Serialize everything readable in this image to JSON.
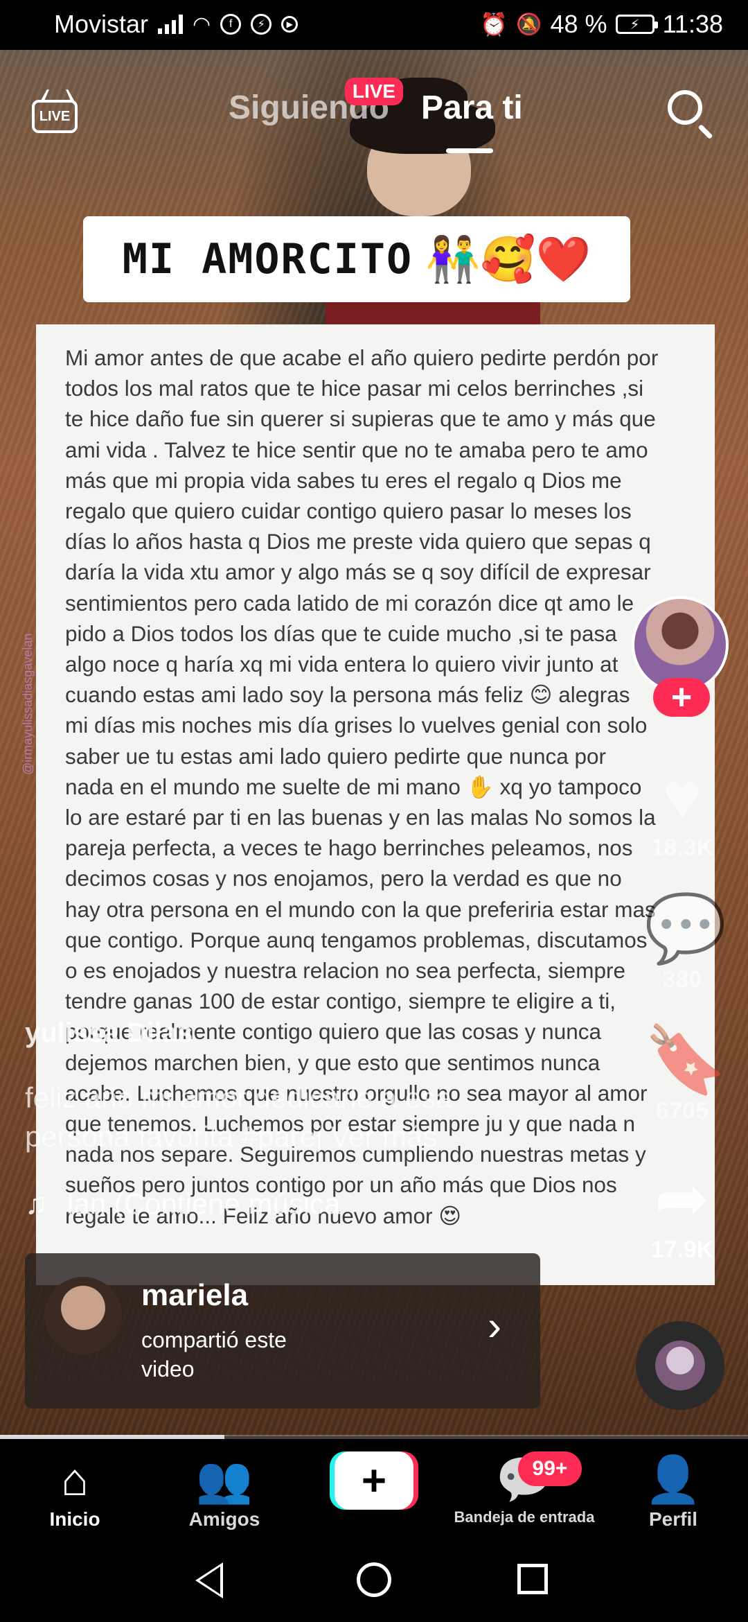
{
  "status_bar": {
    "carrier": "Movistar",
    "battery_percent": "48 %",
    "time": "11:38"
  },
  "top_nav": {
    "live_icon_label": "LIVE",
    "live_badge": "LIVE",
    "tab_following": "Siguiendo",
    "tab_for_you": "Para ti",
    "active_tab": "Para ti"
  },
  "video": {
    "title_card_text": "MI AMORCITO",
    "title_card_emoji": "👫🥰❤️",
    "letter_text": "Mi amor antes de que acabe el año quiero pedirte perdón por\ntodos los mal ratos que te hice pasar mi celos  berrinches ,si\nte hice daño fue sin querer si supieras que te amo y más que\nami vida . Talvez te hice sentir que no te amaba pero te amo\nmás que mi propia vida sabes tu eres el regalo q Dios me\nregalo que quiero cuidar contigo quiero pasar lo meses los\ndías lo años hasta q Dios me preste vida quiero que sepas q\ndaría la vida xtu amor y algo más se q soy difícil de expresar\nsentimientos pero cada latido de mi corazón dice qt amo le\npido a Dios todos los días que te cuide mucho ,si te pasa\nalgo noce q haría xq mi vida entera lo quiero vivir junto at\ncuando estas ami lado soy la persona más feliz 😊 alegras\nmi días mis noches mis día grises lo vuelves genial con solo\nsaber ue tu estas ami lado quiero pedirte que nunca por\nnada en el mundo me suelte de mi mano ✋ xq yo tampoco\nlo are estaré par ti en las buenas y en las malas  No somos la\npareja perfecta, a veces te hago berrinches peleamos, nos\ndecimos cosas y nos enojamos, pero la verdad es que no\nhay otra persona en el mundo con la que preferiria estar mas\nque contigo. Porque aunq tengamos problemas, discutamos\no es enojados y nuestra relacion no sea perfecta, siempre\ntendre ganas 100 de estar contigo, siempre te eligire a ti,\nporque realmente contigo quiero que las cosas y  nunca\ndejemos marchen bien, y que esto que sentimos nunca\nacabe. Luchemos que nuestro orgullo no sea mayor al amor\nque tenemos. Luchemos por estar siempre ju y que nada n\nnada nos separe. Seguiremos cumpliendo nuestras metas y\nsueños pero juntos contigo por un año más que Dios nos\nregale te amo... Feliz año nuevo amor 😍",
    "side_watermark": "@irmayulissadiasgavelan",
    "progress_fraction": 0.3
  },
  "caption": {
    "author": "yulissa Dilas",
    "text": "feliz año mi amor dedicarle a esa persona favorita #parej  Ver más",
    "music": "lan (Contiene música"
  },
  "actions": {
    "follow_symbol": "+",
    "likes": "18.3K",
    "comments": "380",
    "saves": "6705",
    "shares": "17.9K"
  },
  "shared_by": {
    "name": "mariela",
    "subtitle": "compartió este video"
  },
  "bottom_nav": {
    "home": "Inicio",
    "friends": "Amigos",
    "create_symbol": "+",
    "inbox": "Bandeja de entrada",
    "inbox_badge": "99+",
    "profile": "Perfil"
  },
  "icons": {
    "home": "home-icon",
    "friends": "friends-icon",
    "inbox": "inbox-icon",
    "profile": "profile-icon",
    "search": "search-icon",
    "heart": "heart-icon",
    "comment": "comment-icon",
    "bookmark": "bookmark-icon",
    "share": "share-icon",
    "music": "music-note-icon"
  },
  "colors": {
    "accent": "#fe2c55",
    "create_left": "#25f4ee",
    "create_right": "#fe2c55"
  }
}
